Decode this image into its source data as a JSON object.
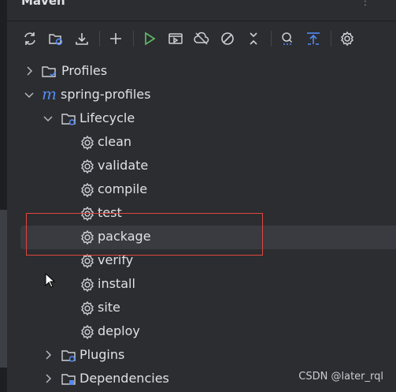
{
  "panel": {
    "title": "Maven"
  },
  "toolbar": {
    "icons": [
      "refresh-icon",
      "reimport-icon",
      "download-icon",
      "add-icon",
      "run-icon",
      "run-config-icon",
      "offline-icon",
      "skip-tests-icon",
      "collapse-icon",
      "analyze-dependencies-icon",
      "show-dependencies-icon",
      "settings-icon"
    ]
  },
  "tree": {
    "profiles": "Profiles",
    "project": "spring-profiles",
    "lifecycle": "Lifecycle",
    "goals": [
      "clean",
      "validate",
      "compile",
      "test",
      "package",
      "verify",
      "install",
      "site",
      "deploy"
    ],
    "plugins": "Plugins",
    "dependencies": "Dependencies",
    "selected_goal": "package"
  },
  "colors": {
    "accent": "#548af7",
    "run_green": "#5fb865",
    "highlight": "#e0463e",
    "selection": "#393b40"
  },
  "watermark": "CSDN @later_rql"
}
